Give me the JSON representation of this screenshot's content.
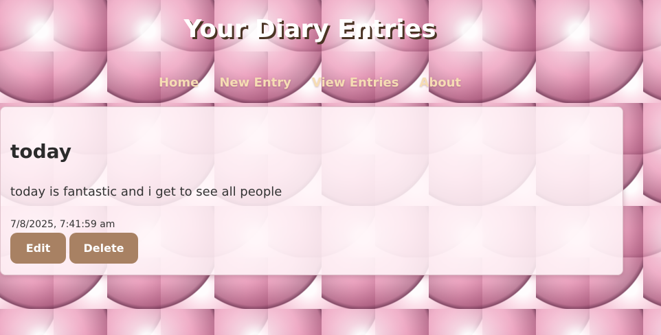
{
  "header": {
    "title": "Your Diary Entries"
  },
  "nav": {
    "items": [
      {
        "label": "Home"
      },
      {
        "label": "New Entry"
      },
      {
        "label": "View Entries"
      },
      {
        "label": "About"
      }
    ]
  },
  "entry": {
    "title": "today",
    "body": "today is fantastic and i get to see all people",
    "timestamp": "7/8/2025, 7:41:59 am",
    "actions": {
      "edit_label": "Edit",
      "delete_label": "Delete"
    }
  },
  "colors": {
    "button_bg": "#a88163",
    "nav_link": "#f6dcb4",
    "title_shadow": "#4a3424",
    "background": "#f2c3d3"
  },
  "background": {
    "icon": "pink-pearls-background-image"
  }
}
